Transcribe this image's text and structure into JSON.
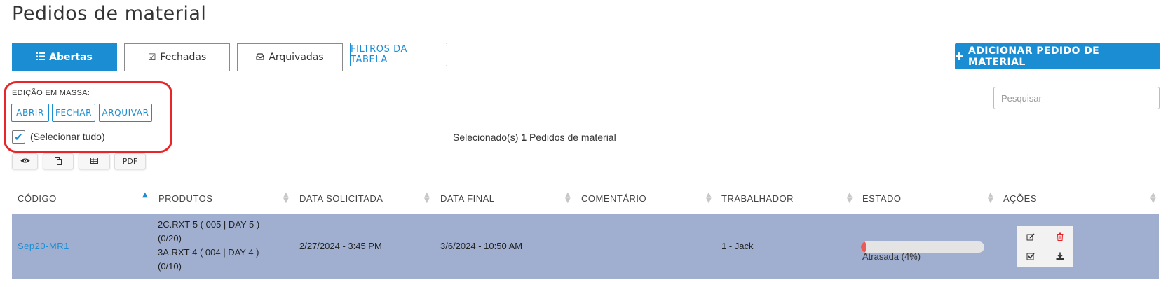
{
  "page": {
    "title": "Pedidos de material"
  },
  "tabs": [
    {
      "label": "Abertas",
      "icon": "list-icon",
      "active": true
    },
    {
      "label": "Fechadas",
      "icon": "check-square-icon",
      "active": false
    },
    {
      "label": "Arquivadas",
      "icon": "inbox-icon",
      "active": false
    }
  ],
  "filters_label": "FILTROS DA TABELA",
  "add_button_label": "ADICIONAR PEDIDO DE MATERIAL",
  "search": {
    "placeholder": "Pesquisar",
    "value": ""
  },
  "mass_edit": {
    "label": "EDIÇÃO EM MASSA:",
    "buttons": [
      "ABRIR",
      "FECHAR",
      "ARQUIVAR"
    ],
    "select_all_label": "(Selecionar tudo)",
    "select_all_checked": true
  },
  "selection": {
    "prefix": "Selecionado(s)",
    "count": "1",
    "suffix": "Pedidos de material"
  },
  "toolbar": [
    {
      "icon": "eye-icon",
      "label": ""
    },
    {
      "icon": "copy-icon",
      "label": ""
    },
    {
      "icon": "table-icon",
      "label": ""
    },
    {
      "icon": "pdf-icon",
      "label": "PDF"
    }
  ],
  "table": {
    "columns": [
      "CÓDIGO",
      "PRODUTOS",
      "DATA SOLICITADA",
      "DATA FINAL",
      "COMENTÁRIO",
      "TRABALHADOR",
      "ESTADO",
      "AÇÕES"
    ],
    "sorted_column": "CÓDIGO",
    "sort_direction": "ascending",
    "rows": [
      {
        "code": "Sep20-MR1",
        "products": [
          "2C.RXT-5 ( 005 | DAY 5 )",
          "(0/20)",
          "3A.RXT-4 ( 004 | DAY 4 )",
          "(0/10)"
        ],
        "requested_date": "2/27/2024 - 3:45 PM",
        "final_date": "3/6/2024 - 10:50 AM",
        "comment": "",
        "worker": "1 - Jack",
        "status_label": "Atrasada (4%)",
        "progress_percent": 4,
        "selected": true,
        "actions": [
          "edit-icon",
          "trash-icon",
          "check-square-icon",
          "download-icon"
        ]
      }
    ]
  },
  "colors": {
    "primary": "#1b8ed3",
    "row_selected": "#a0afd0",
    "danger": "#e8262a",
    "progress_fill": "#ea5b57"
  }
}
